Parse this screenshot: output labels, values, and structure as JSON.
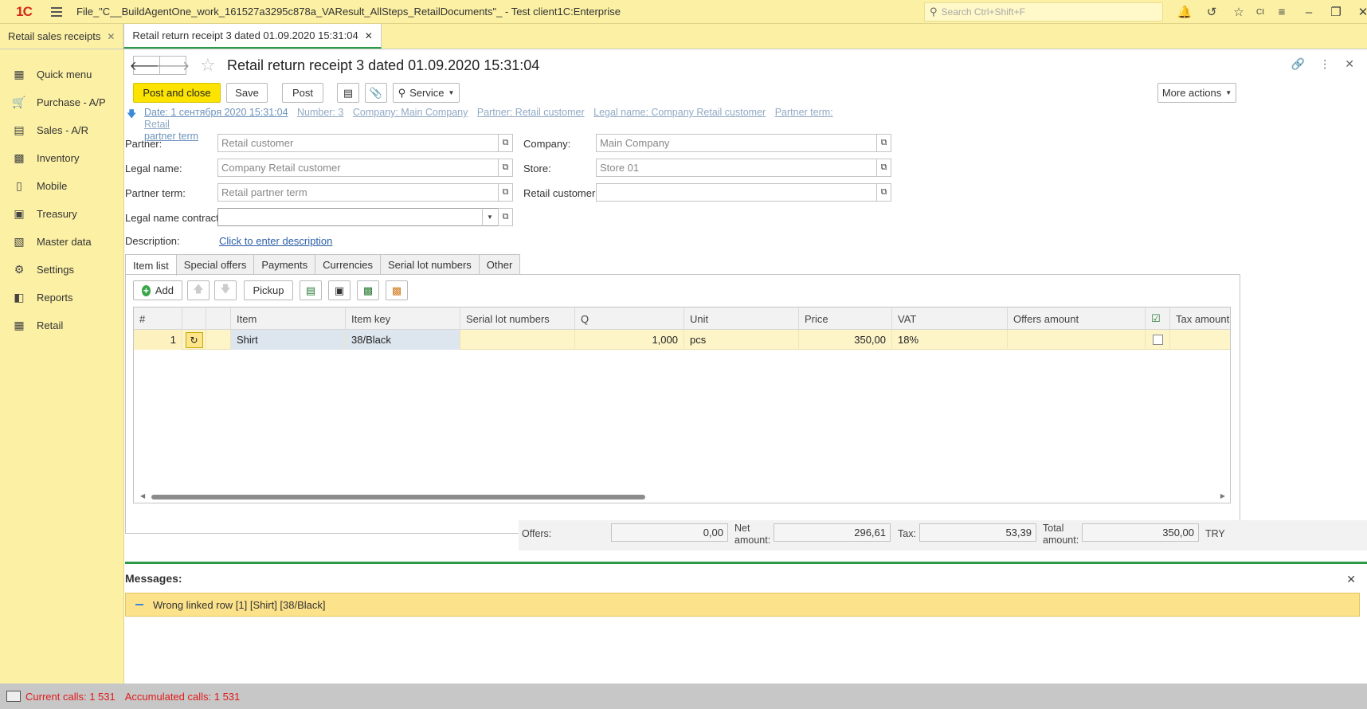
{
  "window": {
    "title": "File_\"C__BuildAgentOne_work_161527a3295c878a_VAResult_AllSteps_RetailDocuments\"_  - Test client1C:Enterprise",
    "search_placeholder": "Search Ctrl+Shift+F",
    "logo": "1C"
  },
  "open_tabs": [
    {
      "label": "Retail sales receipts"
    },
    {
      "label": "Retail return receipt 3 dated 01.09.2020 15:31:04"
    }
  ],
  "sidebar": {
    "items": [
      {
        "label": "Quick menu",
        "icon": "grid-icon"
      },
      {
        "label": "Purchase  - A/P",
        "icon": "cart-icon"
      },
      {
        "label": "Sales - A/R",
        "icon": "sales-icon"
      },
      {
        "label": "Inventory",
        "icon": "inventory-icon"
      },
      {
        "label": "Mobile",
        "icon": "mobile-icon"
      },
      {
        "label": "Treasury",
        "icon": "treasury-icon"
      },
      {
        "label": "Master data",
        "icon": "master-data-icon"
      },
      {
        "label": "Settings",
        "icon": "gear-icon"
      },
      {
        "label": "Reports",
        "icon": "reports-icon"
      },
      {
        "label": "Retail",
        "icon": "retail-icon"
      }
    ]
  },
  "document": {
    "title": "Retail return receipt 3 dated 01.09.2020 15:31:04",
    "buttons": {
      "post_and_close": "Post and close",
      "save": "Save",
      "post": "Post",
      "service": "Service",
      "more_actions": "More actions"
    },
    "info_links": [
      "Date: 1 сентября 2020 15:31:04",
      "Number: 3",
      "Company: Main Company",
      "Partner: Retail customer",
      "Legal name: Company Retail customer",
      "Partner term: Retail",
      "partner term"
    ],
    "fields": {
      "partner_label": "Partner:",
      "partner_value": "Retail customer",
      "legal_name_label": "Legal name:",
      "legal_name_value": "Company Retail customer",
      "partner_term_label": "Partner term:",
      "partner_term_value": "Retail partner term",
      "legal_name_contract_label": "Legal name contract:",
      "legal_name_contract_value": "",
      "description_label": "Description:",
      "description_link": "Click to enter description",
      "company_label": "Company:",
      "company_value": "Main Company",
      "store_label": "Store:",
      "store_value": "Store 01",
      "retail_customer_label": "Retail customer:",
      "retail_customer_value": ""
    },
    "inner_tabs": [
      "Item list",
      "Special offers",
      "Payments",
      "Currencies",
      "Serial lot numbers",
      "Other"
    ],
    "table_toolbar": {
      "add": "Add",
      "pickup": "Pickup"
    },
    "table": {
      "headers": [
        "#",
        "",
        "",
        "Item",
        "Item key",
        "Serial lot numbers",
        "Q",
        "Unit",
        "Price",
        "VAT",
        "Offers amount",
        "",
        "Tax amount"
      ],
      "rows": [
        {
          "num": "1",
          "item": "Shirt",
          "item_key": "38/Black",
          "serial": "",
          "q": "1,000",
          "unit": "pcs",
          "price": "350,00",
          "vat": "18%",
          "offers": "",
          "tax": ""
        }
      ]
    },
    "totals": {
      "offers_label": "Offers:",
      "offers_value": "0,00",
      "net_label_1": "Net",
      "net_label_2": "amount:",
      "net_value": "296,61",
      "tax_label": "Tax:",
      "tax_value": "53,39",
      "total_label_1": "Total",
      "total_label_2": "amount:",
      "total_value": "350,00",
      "currency": "TRY"
    }
  },
  "messages": {
    "title": "Messages:",
    "items": [
      "Wrong linked row [1] [Shirt] [38/Black]"
    ]
  },
  "statusbar": {
    "current_calls": "Current calls: 1 531",
    "accumulated_calls": "Accumulated calls: 1 531"
  }
}
